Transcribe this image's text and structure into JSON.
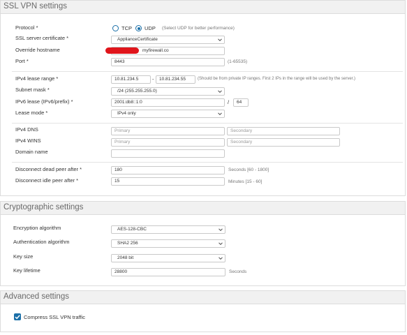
{
  "ssl_vpn": {
    "title": "SSL VPN settings",
    "protocol": {
      "label": "Protocol *",
      "options": [
        "TCP",
        "UDP"
      ],
      "selected": "UDP",
      "hint": "(Select UDP for better performance)"
    },
    "certificate": {
      "label": "SSL server certificate *",
      "value": "ApplianceCertificate"
    },
    "hostname": {
      "label": "Override hostname",
      "value": "myfirewall.co"
    },
    "port": {
      "label": "Port *",
      "value": "8443",
      "hint": "(1-65535)"
    },
    "ipv4_range": {
      "label": "IPv4 lease range *",
      "start": "10.81.234.5",
      "dash": "-",
      "end": "10.81.234.55",
      "hint": "(Should be from private IP ranges. First 2 IPs in the range will be used by the server.)"
    },
    "subnet": {
      "label": "Subnet mask *",
      "value": "/24 (255.255.255.0)"
    },
    "ipv6": {
      "label": "IPv6 lease (IPv6/prefix) *",
      "value": "2001:db8::1:0",
      "slash": "/",
      "prefix": "64"
    },
    "lease_mode": {
      "label": "Lease mode *",
      "value": "IPv4 only"
    },
    "ipv4_dns": {
      "label": "IPv4 DNS",
      "primary": "Primary",
      "secondary": "Secondary"
    },
    "ipv4_wins": {
      "label": "IPv4 WINS",
      "primary": "Primary",
      "secondary": "Secondary"
    },
    "domain": {
      "label": "Domain name",
      "value": ""
    },
    "dead_peer": {
      "label": "Disconnect dead peer after *",
      "value": "180",
      "hint": "Seconds   [60 - 1800]"
    },
    "idle_peer": {
      "label": "Disconnect idle peer after *",
      "value": "15",
      "hint": "Minutes   [15 - 60]"
    }
  },
  "crypto": {
    "title": "Cryptographic settings",
    "encryption": {
      "label": "Encryption algorithm",
      "value": "AES-128-CBC"
    },
    "authentication": {
      "label": "Authentication algorithm",
      "value": "SHA2 256"
    },
    "key_size": {
      "label": "Key size",
      "value": "2048 bit"
    },
    "key_lifetime": {
      "label": "Key lifetime",
      "value": "28800",
      "hint": "Seconds"
    }
  },
  "advanced": {
    "title": "Advanced settings",
    "compress": {
      "label": "Compress SSL VPN traffic",
      "checked": true
    }
  },
  "colors": {
    "accent": "#1a6fa8",
    "redaction": "#e0151b"
  },
  "icons": [
    "radio-icon",
    "chevron-down-icon",
    "checkmark-icon"
  ]
}
